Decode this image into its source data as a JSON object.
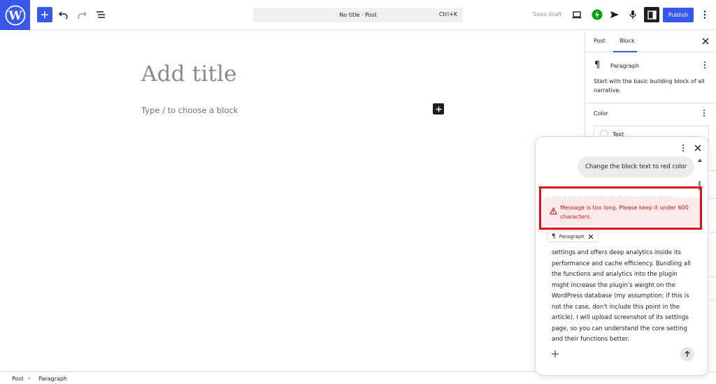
{
  "toolbar": {
    "command_bar_text": "No title · Post",
    "command_shortcut": "Ctrl+K",
    "save_draft_label": "Save draft",
    "publish_label": "Publish",
    "icons": [
      "wordpress-logo-icon",
      "plus-icon",
      "undo-icon",
      "redo-icon",
      "list-view-icon",
      "desktop-preview-icon",
      "jetpack-icon",
      "send-icon",
      "microphone-icon",
      "settings-sidebar-icon",
      "more-options-icon"
    ]
  },
  "editor": {
    "title_placeholder": "Add title",
    "block_placeholder": "Type / to choose a block"
  },
  "sidebar": {
    "tabs": [
      {
        "label": "Post",
        "active": false
      },
      {
        "label": "Block",
        "active": true
      }
    ],
    "block": {
      "name": "Paragraph",
      "description": "Start with the basic building block of all narrative."
    },
    "color_section_label": "Color",
    "color_item_label": "Text"
  },
  "breadcrumb": {
    "items": [
      "Post",
      "Paragraph"
    ]
  },
  "chat": {
    "user_message": "Change the block text to red color",
    "partially_hidden_text": "I can help change the text color of this block",
    "error_message": "Message is too long. Please keep it under 600 characters.",
    "context_chip_label": "Paragraph",
    "input_text": "settings and offers deep analytics inside its performance and cache efficiency. Bundling all the functions and analytics into the plugin might increase the plugin's weight on the WordPress database (my assumption; if this is not the case, don't include this point in the article). I will upload screenshot of its settings page, so you can understand the core setting and their functions better."
  },
  "colors": {
    "accent": "#3858e9",
    "error_text": "#cc1818",
    "error_bg": "#fce9ea",
    "highlight_border": "#e0101a"
  }
}
